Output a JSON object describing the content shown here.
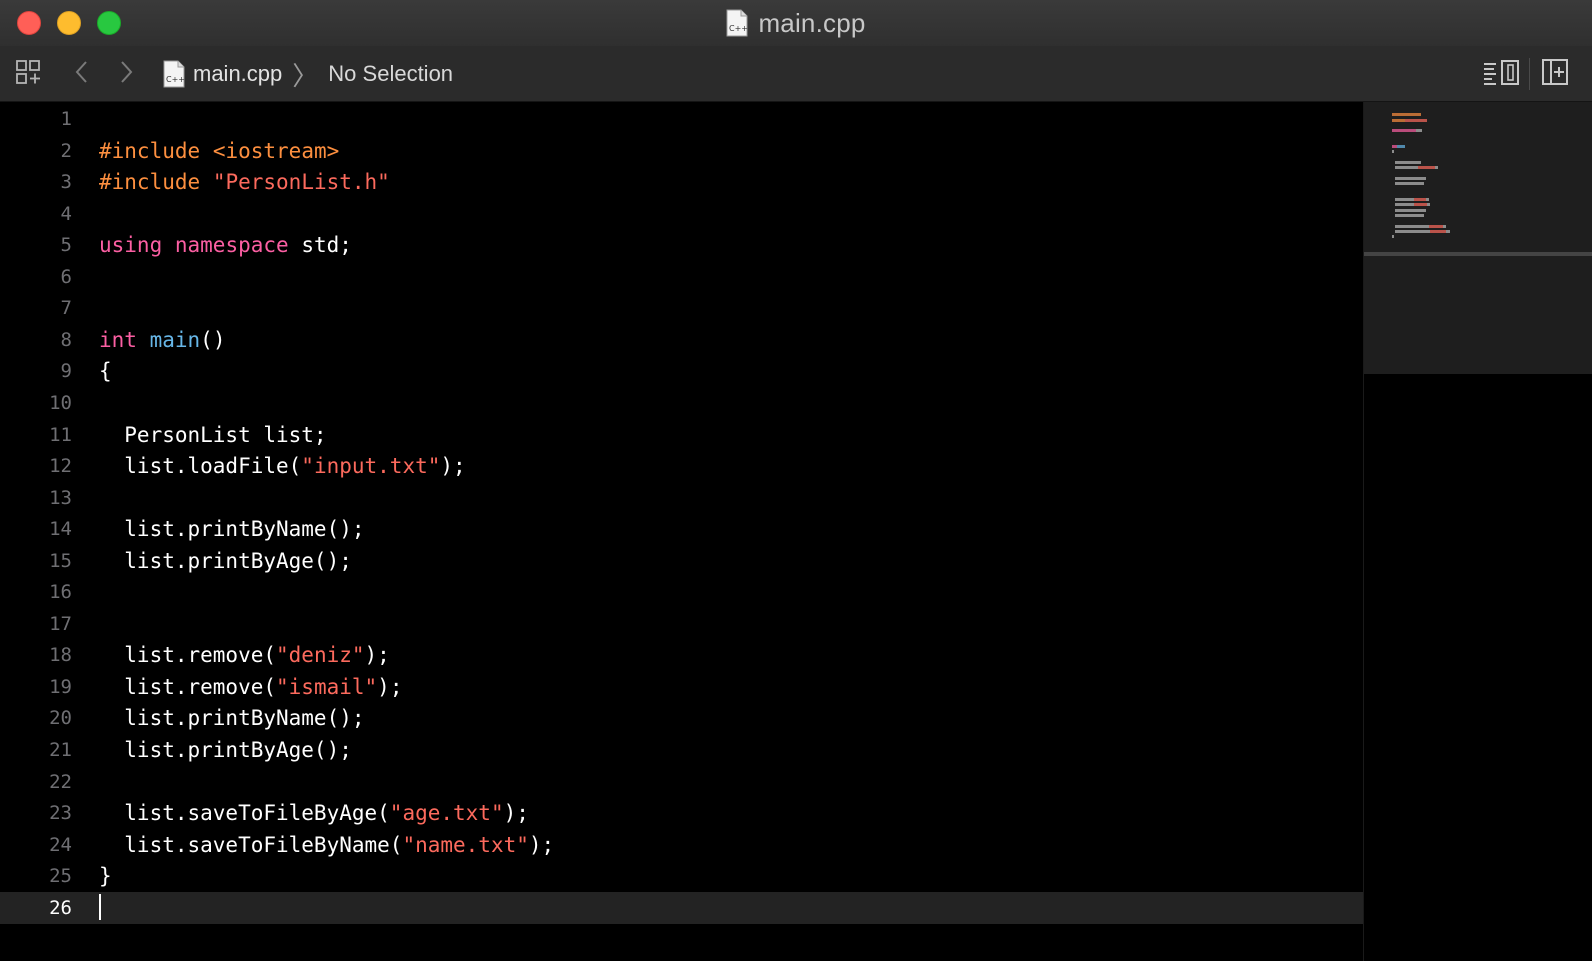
{
  "window": {
    "title": "main.cpp",
    "file_icon_label": "C++"
  },
  "toolbar": {
    "breadcrumb_file": "main.cpp",
    "breadcrumb_selection": "No Selection",
    "breadcrumb_separator": "〉"
  },
  "editor": {
    "current_line": 26,
    "lines": [
      {
        "n": "1",
        "code": ""
      },
      {
        "n": "2",
        "code": "#include <iostream>"
      },
      {
        "n": "3",
        "code": "#include \"PersonList.h\""
      },
      {
        "n": "4",
        "code": ""
      },
      {
        "n": "5",
        "code": "using namespace std;"
      },
      {
        "n": "6",
        "code": ""
      },
      {
        "n": "7",
        "code": ""
      },
      {
        "n": "8",
        "code": "int main()"
      },
      {
        "n": "9",
        "code": "{"
      },
      {
        "n": "10",
        "code": ""
      },
      {
        "n": "11",
        "code": "  PersonList list;"
      },
      {
        "n": "12",
        "code": "  list.loadFile(\"input.txt\");"
      },
      {
        "n": "13",
        "code": ""
      },
      {
        "n": "14",
        "code": "  list.printByName();"
      },
      {
        "n": "15",
        "code": "  list.printByAge();"
      },
      {
        "n": "16",
        "code": ""
      },
      {
        "n": "17",
        "code": ""
      },
      {
        "n": "18",
        "code": "  list.remove(\"deniz\");"
      },
      {
        "n": "19",
        "code": "  list.remove(\"ismail\");"
      },
      {
        "n": "20",
        "code": "  list.printByName();"
      },
      {
        "n": "21",
        "code": "  list.printByAge();"
      },
      {
        "n": "22",
        "code": ""
      },
      {
        "n": "23",
        "code": "  list.saveToFileByAge(\"age.txt\");"
      },
      {
        "n": "24",
        "code": "  list.saveToFileByName(\"name.txt\");"
      },
      {
        "n": "25",
        "code": "}"
      },
      {
        "n": "26",
        "code": ""
      }
    ]
  },
  "icons": {
    "related_items": "related-items-icon",
    "back": "chevron-left-icon",
    "forward": "chevron-right-icon",
    "adjust_editor": "editor-options-icon",
    "add_editor": "add-editor-icon"
  },
  "colors": {
    "preprocessor": "#fd8f3f",
    "string": "#fc6a5d",
    "keyword": "#fc5fa3",
    "function": "#67b7e8",
    "plain": "#ffffff",
    "line_number": "#6f6f73",
    "current_line_bg": "#232323"
  }
}
